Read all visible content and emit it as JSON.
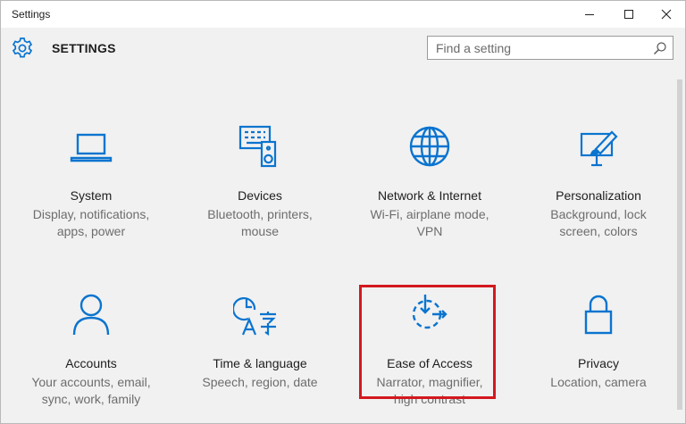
{
  "window": {
    "title": "Settings"
  },
  "header": {
    "title": "SETTINGS",
    "search_placeholder": "Find a setting"
  },
  "colors": {
    "accent": "#0a74cf",
    "highlight": "#d3191f"
  },
  "tiles": [
    {
      "icon": "laptop-icon",
      "title": "System",
      "desc": [
        "Display, notifications,",
        "apps, power"
      ]
    },
    {
      "icon": "devices-icon",
      "title": "Devices",
      "desc": [
        "Bluetooth, printers,",
        "mouse"
      ]
    },
    {
      "icon": "globe-icon",
      "title": "Network & Internet",
      "desc": [
        "Wi-Fi, airplane mode,",
        "VPN"
      ]
    },
    {
      "icon": "personalization-icon",
      "title": "Personalization",
      "desc": [
        "Background, lock",
        "screen, colors"
      ]
    },
    {
      "icon": "person-icon",
      "title": "Accounts",
      "desc": [
        "Your accounts, email,",
        "sync, work, family"
      ]
    },
    {
      "icon": "time-language-icon",
      "title": "Time & language",
      "desc": [
        "Speech, region, date"
      ]
    },
    {
      "icon": "ease-of-access-icon",
      "title": "Ease of Access",
      "desc": [
        "Narrator, magnifier,",
        "high contrast"
      ]
    },
    {
      "icon": "lock-icon",
      "title": "Privacy",
      "desc": [
        "Location, camera"
      ]
    }
  ]
}
